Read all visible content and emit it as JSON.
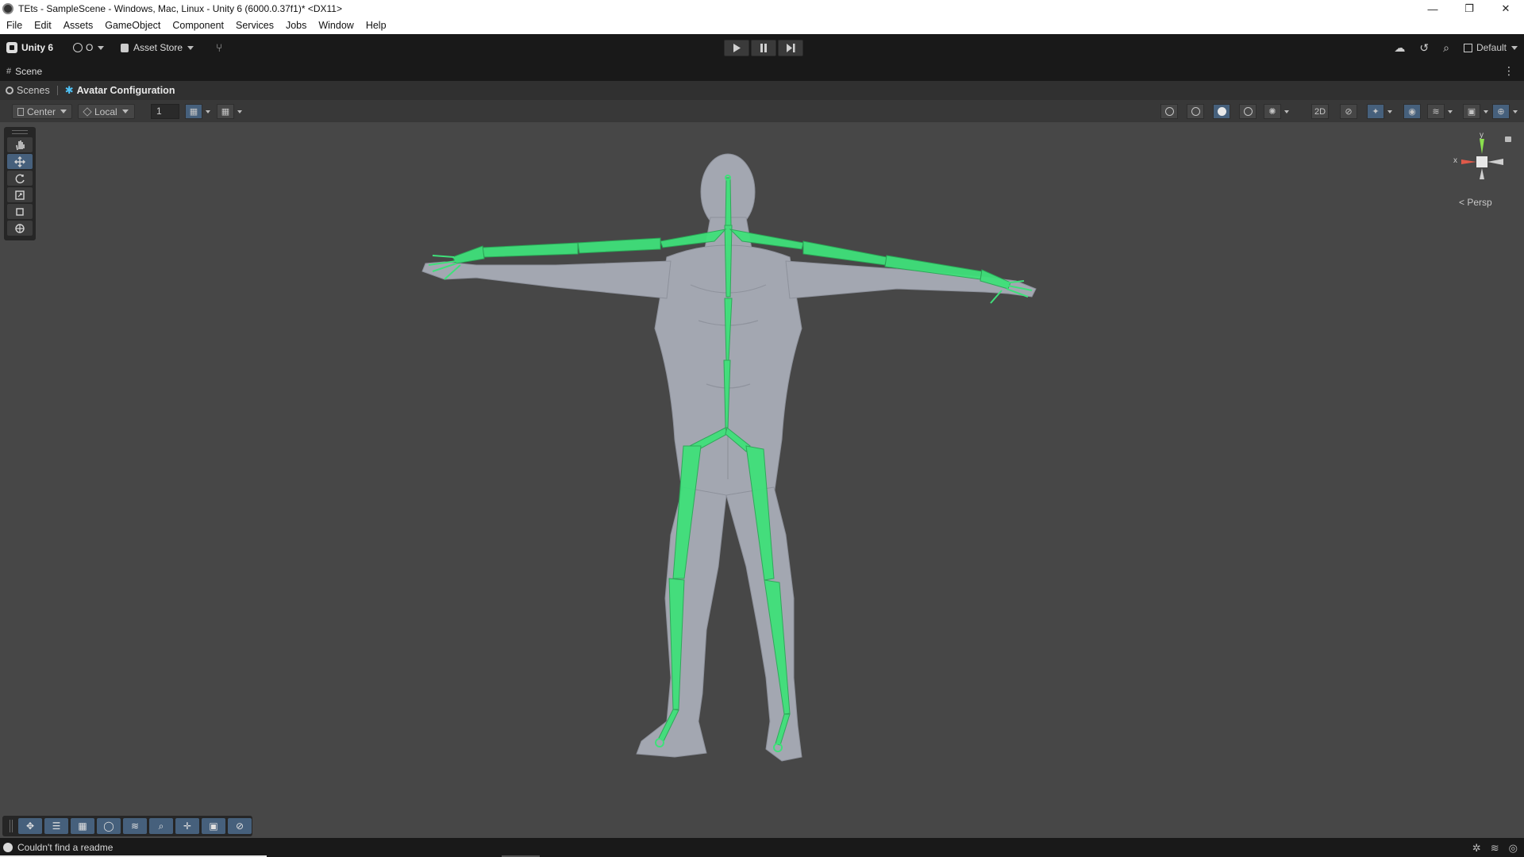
{
  "window": {
    "title": "TEts - SampleScene - Windows, Mac, Linux - Unity 6 (6000.0.37f1)* <DX11>",
    "minimize": "—",
    "restore": "❐",
    "close": "✕"
  },
  "menu": {
    "items": [
      "File",
      "Edit",
      "Assets",
      "GameObject",
      "Component",
      "Services",
      "Jobs",
      "Window",
      "Help"
    ]
  },
  "toolbar": {
    "product": "Unity 6",
    "account_label": "O",
    "asset_store": "Asset Store",
    "layout": "Default"
  },
  "tab": {
    "label": "Scene"
  },
  "breadcrumb": {
    "root": "Scenes",
    "current": "Avatar Configuration"
  },
  "scene_toolbar": {
    "pivot": "Center",
    "space": "Local",
    "snap_value": "1"
  },
  "viewport": {
    "projection": "Persp",
    "gizmo_axes": {
      "x": "x",
      "y": "y"
    },
    "model_color": "#a3a7b1",
    "bone_color": "#3fe07a",
    "background": "#474747"
  },
  "status": {
    "message": "Couldn't find a readme"
  }
}
